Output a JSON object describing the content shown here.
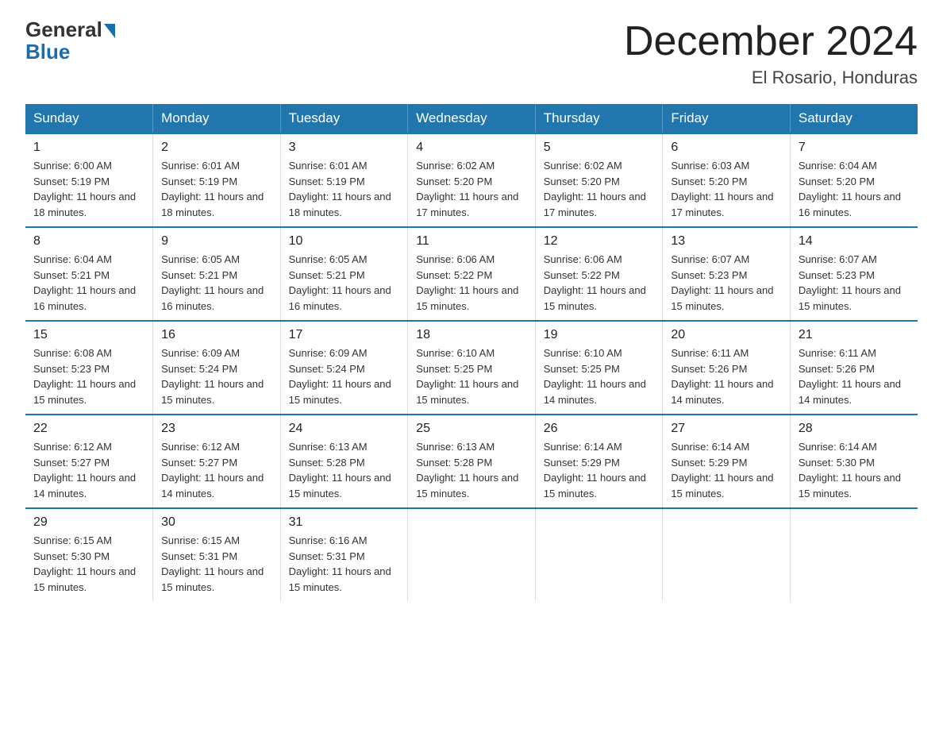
{
  "logo": {
    "general": "General",
    "blue": "Blue"
  },
  "header": {
    "month": "December 2024",
    "location": "El Rosario, Honduras"
  },
  "days_of_week": [
    "Sunday",
    "Monday",
    "Tuesday",
    "Wednesday",
    "Thursday",
    "Friday",
    "Saturday"
  ],
  "weeks": [
    [
      {
        "day": "1",
        "sunrise": "6:00 AM",
        "sunset": "5:19 PM",
        "daylight": "11 hours and 18 minutes."
      },
      {
        "day": "2",
        "sunrise": "6:01 AM",
        "sunset": "5:19 PM",
        "daylight": "11 hours and 18 minutes."
      },
      {
        "day": "3",
        "sunrise": "6:01 AM",
        "sunset": "5:19 PM",
        "daylight": "11 hours and 18 minutes."
      },
      {
        "day": "4",
        "sunrise": "6:02 AM",
        "sunset": "5:20 PM",
        "daylight": "11 hours and 17 minutes."
      },
      {
        "day": "5",
        "sunrise": "6:02 AM",
        "sunset": "5:20 PM",
        "daylight": "11 hours and 17 minutes."
      },
      {
        "day": "6",
        "sunrise": "6:03 AM",
        "sunset": "5:20 PM",
        "daylight": "11 hours and 17 minutes."
      },
      {
        "day": "7",
        "sunrise": "6:04 AM",
        "sunset": "5:20 PM",
        "daylight": "11 hours and 16 minutes."
      }
    ],
    [
      {
        "day": "8",
        "sunrise": "6:04 AM",
        "sunset": "5:21 PM",
        "daylight": "11 hours and 16 minutes."
      },
      {
        "day": "9",
        "sunrise": "6:05 AM",
        "sunset": "5:21 PM",
        "daylight": "11 hours and 16 minutes."
      },
      {
        "day": "10",
        "sunrise": "6:05 AM",
        "sunset": "5:21 PM",
        "daylight": "11 hours and 16 minutes."
      },
      {
        "day": "11",
        "sunrise": "6:06 AM",
        "sunset": "5:22 PM",
        "daylight": "11 hours and 15 minutes."
      },
      {
        "day": "12",
        "sunrise": "6:06 AM",
        "sunset": "5:22 PM",
        "daylight": "11 hours and 15 minutes."
      },
      {
        "day": "13",
        "sunrise": "6:07 AM",
        "sunset": "5:23 PM",
        "daylight": "11 hours and 15 minutes."
      },
      {
        "day": "14",
        "sunrise": "6:07 AM",
        "sunset": "5:23 PM",
        "daylight": "11 hours and 15 minutes."
      }
    ],
    [
      {
        "day": "15",
        "sunrise": "6:08 AM",
        "sunset": "5:23 PM",
        "daylight": "11 hours and 15 minutes."
      },
      {
        "day": "16",
        "sunrise": "6:09 AM",
        "sunset": "5:24 PM",
        "daylight": "11 hours and 15 minutes."
      },
      {
        "day": "17",
        "sunrise": "6:09 AM",
        "sunset": "5:24 PM",
        "daylight": "11 hours and 15 minutes."
      },
      {
        "day": "18",
        "sunrise": "6:10 AM",
        "sunset": "5:25 PM",
        "daylight": "11 hours and 15 minutes."
      },
      {
        "day": "19",
        "sunrise": "6:10 AM",
        "sunset": "5:25 PM",
        "daylight": "11 hours and 14 minutes."
      },
      {
        "day": "20",
        "sunrise": "6:11 AM",
        "sunset": "5:26 PM",
        "daylight": "11 hours and 14 minutes."
      },
      {
        "day": "21",
        "sunrise": "6:11 AM",
        "sunset": "5:26 PM",
        "daylight": "11 hours and 14 minutes."
      }
    ],
    [
      {
        "day": "22",
        "sunrise": "6:12 AM",
        "sunset": "5:27 PM",
        "daylight": "11 hours and 14 minutes."
      },
      {
        "day": "23",
        "sunrise": "6:12 AM",
        "sunset": "5:27 PM",
        "daylight": "11 hours and 14 minutes."
      },
      {
        "day": "24",
        "sunrise": "6:13 AM",
        "sunset": "5:28 PM",
        "daylight": "11 hours and 15 minutes."
      },
      {
        "day": "25",
        "sunrise": "6:13 AM",
        "sunset": "5:28 PM",
        "daylight": "11 hours and 15 minutes."
      },
      {
        "day": "26",
        "sunrise": "6:14 AM",
        "sunset": "5:29 PM",
        "daylight": "11 hours and 15 minutes."
      },
      {
        "day": "27",
        "sunrise": "6:14 AM",
        "sunset": "5:29 PM",
        "daylight": "11 hours and 15 minutes."
      },
      {
        "day": "28",
        "sunrise": "6:14 AM",
        "sunset": "5:30 PM",
        "daylight": "11 hours and 15 minutes."
      }
    ],
    [
      {
        "day": "29",
        "sunrise": "6:15 AM",
        "sunset": "5:30 PM",
        "daylight": "11 hours and 15 minutes."
      },
      {
        "day": "30",
        "sunrise": "6:15 AM",
        "sunset": "5:31 PM",
        "daylight": "11 hours and 15 minutes."
      },
      {
        "day": "31",
        "sunrise": "6:16 AM",
        "sunset": "5:31 PM",
        "daylight": "11 hours and 15 minutes."
      },
      null,
      null,
      null,
      null
    ]
  ]
}
